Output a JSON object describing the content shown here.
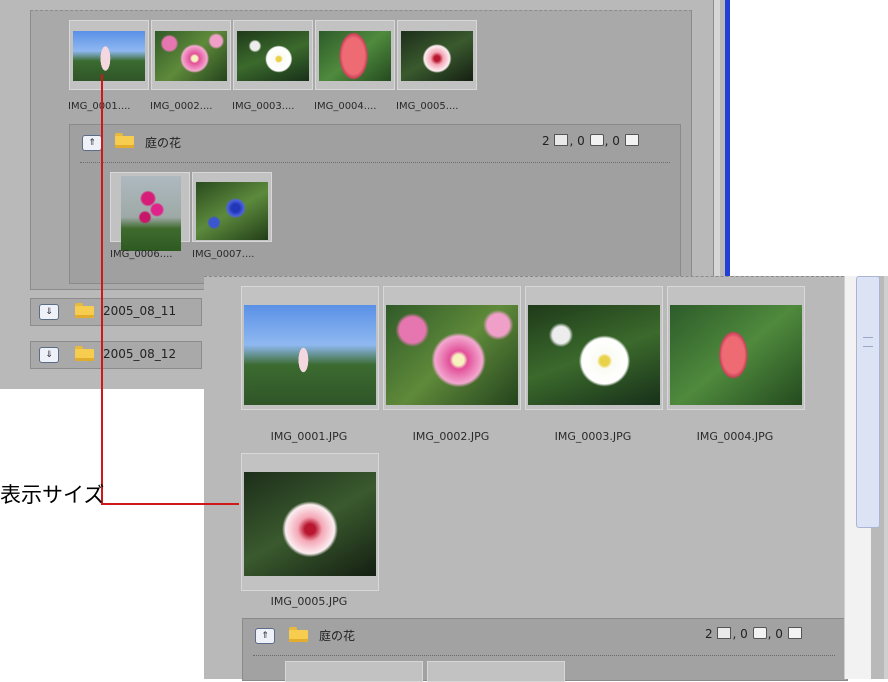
{
  "back_panel": {
    "thumbnails": [
      {
        "caption": "IMG_0001....",
        "photo": "sky-blossom"
      },
      {
        "caption": "IMG_0002....",
        "photo": "pink-clematis"
      },
      {
        "caption": "IMG_0003....",
        "photo": "white-flower"
      },
      {
        "caption": "IMG_0004....",
        "photo": "red-bracts"
      },
      {
        "caption": "IMG_0005....",
        "photo": "pink-lily"
      }
    ],
    "subgroup": {
      "title": "庭の花",
      "counts": {
        "images": "2",
        "sep1": ", 0",
        "sep2": ", 0"
      },
      "thumbnails": [
        {
          "caption": "IMG_0006....",
          "photo": "magenta-primrose"
        },
        {
          "caption": "IMG_0007....",
          "photo": "blue-cornflower"
        }
      ]
    },
    "collapsed_groups": [
      {
        "title": "2005_08_11"
      },
      {
        "title": "2005_08_12"
      }
    ]
  },
  "front_panel": {
    "thumbnails": [
      {
        "caption": "IMG_0001.JPG",
        "photo": "sky-blossom"
      },
      {
        "caption": "IMG_0002.JPG",
        "photo": "pink-clematis"
      },
      {
        "caption": "IMG_0003.JPG",
        "photo": "white-flower"
      },
      {
        "caption": "IMG_0004.JPG",
        "photo": "red-bracts"
      },
      {
        "caption": "IMG_0005.JPG",
        "photo": "pink-lily"
      }
    ],
    "subgroup": {
      "title": "庭の花",
      "counts": {
        "images": "2",
        "sep1": ", 0",
        "sep2": ", 0"
      }
    }
  },
  "callout": {
    "label": "表示サイズ",
    "color": "#d01818"
  },
  "icons": {
    "expand": "chevron-up-icon",
    "collapse": "chevron-down-icon",
    "folder": "folder-icon",
    "image_count": "image-icon",
    "music_count": "music-note-icon",
    "folder_count": "folder-icon"
  }
}
